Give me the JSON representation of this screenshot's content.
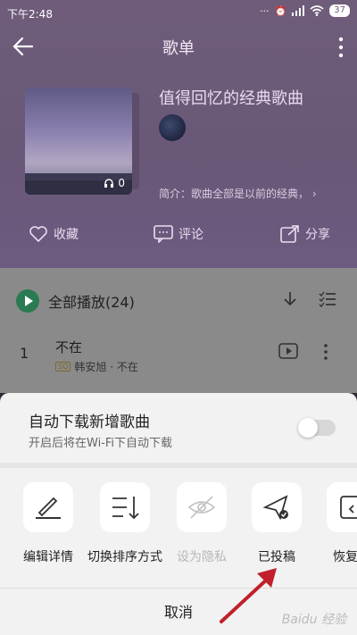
{
  "status": {
    "time": "下午2:48",
    "battery": "37"
  },
  "header": {
    "title": "歌单"
  },
  "playlist": {
    "title": "值得回忆的经典歌曲",
    "play_count": "0",
    "intro": "简介：歌曲全部是以前的经典，"
  },
  "actions": {
    "collect": "收藏",
    "comment": "评论",
    "share": "分享"
  },
  "list": {
    "play_all": "全部播放(24)",
    "songs": [
      {
        "no": "1",
        "title": "不在",
        "quality": "SQ",
        "sub": "韩安旭 · 不在"
      }
    ]
  },
  "sheet": {
    "auto_download_title": "自动下载新增歌曲",
    "auto_download_desc": "开启后将在Wi-Fi下自动下载",
    "auto_download_on": false,
    "ops": [
      {
        "label": "编辑详情",
        "icon": "edit-icon",
        "enabled": true
      },
      {
        "label": "切换排序方式",
        "icon": "sort-icon",
        "enabled": true
      },
      {
        "label": "设为隐私",
        "icon": "eye-off-icon",
        "enabled": false
      },
      {
        "label": "已投稿",
        "icon": "send-icon",
        "enabled": true
      },
      {
        "label": "恢复歌",
        "icon": "restore-icon",
        "enabled": true
      }
    ],
    "cancel": "取消"
  },
  "watermark": "Baidu 经验",
  "colors": {
    "accent_green": "#2a7a52",
    "hero_purple": "#6e5c7a",
    "annotation_red": "#c0202a"
  }
}
